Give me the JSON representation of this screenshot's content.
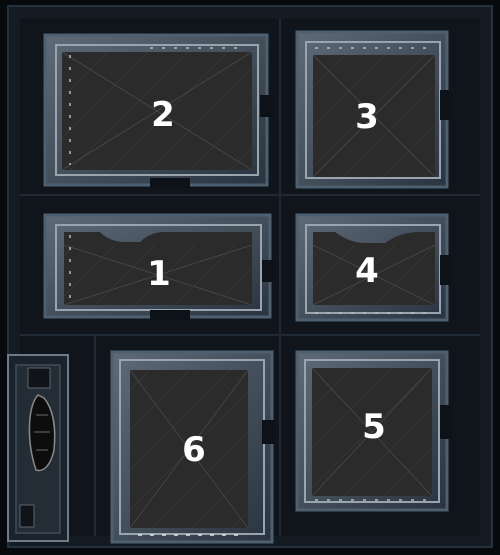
{
  "map": {
    "rooms": [
      {
        "number": "2"
      },
      {
        "number": "3"
      },
      {
        "number": "1"
      },
      {
        "number": "4"
      },
      {
        "number": "6"
      },
      {
        "number": "5"
      }
    ]
  },
  "colors": {
    "background": "#070a0d",
    "corridor": "#161d24",
    "wall_outer": "#3a4a5a",
    "wall_trim": "#7b8794",
    "floor": "#2b2b2b",
    "rivet": "#c3c3c3",
    "label": "#ffffff"
  }
}
